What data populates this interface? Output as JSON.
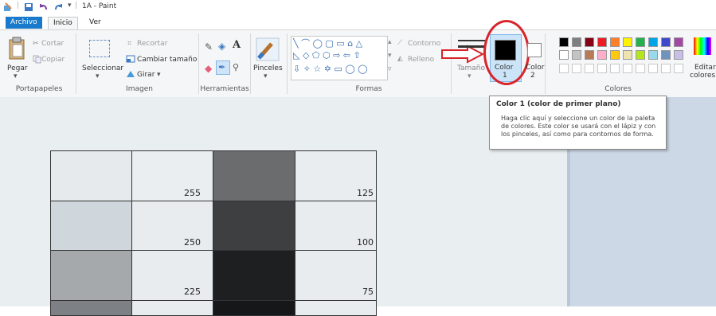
{
  "titlebar": {
    "title": "1A - Paint"
  },
  "tabs": {
    "file": "Archivo",
    "home": "Inicio",
    "view": "Ver"
  },
  "clipboard": {
    "paste": "Pegar",
    "cut": "Cortar",
    "copy": "Copiar",
    "group": "Portapapeles"
  },
  "image": {
    "select": "Seleccionar",
    "crop": "Recortar",
    "resize": "Cambiar tamaño",
    "rotate": "Girar",
    "group": "Imagen"
  },
  "tools": {
    "group": "Herramientas",
    "text_tool": "A"
  },
  "brushes": {
    "label": "Pinceles"
  },
  "shapes": {
    "outline": "Contorno",
    "fill": "Relleno",
    "group": "Formas",
    "glyphs_row1": "╲ ⌒ ◯ ▢ ▭ ⌂ △",
    "glyphs_row2": "◺ ◇ ⬠ ⬡ ⇨ ⇦ ⇧",
    "glyphs_row3": "⇩ ✧ ☆ ✡ ▭ ◯ ◯"
  },
  "size": {
    "label": "Tamaño"
  },
  "color1": {
    "label": "Color",
    "num": "1"
  },
  "color2": {
    "label": "Color",
    "num": "2"
  },
  "colors": {
    "group": "Colores",
    "edit_label_1": "Editar",
    "edit_label_2": "colores",
    "row1": [
      "#000000",
      "#7f7f7f",
      "#880015",
      "#ed1c24",
      "#ff7f27",
      "#fff200",
      "#22b14c",
      "#00a2e8",
      "#3f48cc",
      "#a349a4"
    ],
    "row2": [
      "#ffffff",
      "#c3c3c3",
      "#b97a57",
      "#ffaec9",
      "#ffc90e",
      "#efe4b0",
      "#b5e61d",
      "#99d9ea",
      "#7092be",
      "#c8bfe7"
    ]
  },
  "tooltip": {
    "title": "Color 1 (color de primer plano)",
    "body": "Haga clic aquí y seleccione un color de la paleta de colores. Este color se usará con el lápiz y con los pinceles, así como para contornos de forma."
  },
  "canvas": {
    "numbers_left": [
      "255",
      "250",
      "225"
    ],
    "numbers_right": [
      "125",
      "100",
      "75"
    ]
  }
}
